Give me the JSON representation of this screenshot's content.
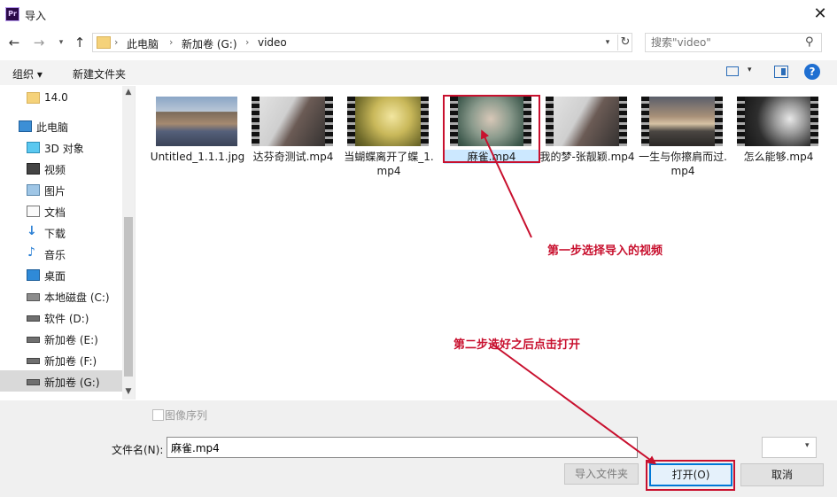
{
  "window": {
    "title": "导入",
    "app_badge": "Pr"
  },
  "address": {
    "crumbs": [
      "此电脑",
      "新加卷 (G:)",
      "video"
    ],
    "search_placeholder": "搜索\"video\""
  },
  "toolbar": {
    "organize": "组织 ▾",
    "new_folder": "新建文件夹"
  },
  "sidebar": {
    "items": [
      {
        "label": "14.0",
        "icon": "folder-icon"
      },
      {
        "label": "此电脑",
        "icon": "computer-icon"
      },
      {
        "label": "3D 对象",
        "icon": "3d-objects-icon"
      },
      {
        "label": "视频",
        "icon": "video-folder-icon"
      },
      {
        "label": "图片",
        "icon": "pictures-folder-icon"
      },
      {
        "label": "文档",
        "icon": "documents-folder-icon"
      },
      {
        "label": "下载",
        "icon": "download-arrow-icon"
      },
      {
        "label": "音乐",
        "icon": "music-note-icon"
      },
      {
        "label": "桌面",
        "icon": "desktop-icon"
      },
      {
        "label": "本地磁盘 (C:)",
        "icon": "system-drive-icon"
      },
      {
        "label": "软件 (D:)",
        "icon": "drive-icon"
      },
      {
        "label": "新加卷 (E:)",
        "icon": "drive-icon"
      },
      {
        "label": "新加卷 (F:)",
        "icon": "drive-icon"
      },
      {
        "label": "新加卷 (G:)",
        "icon": "drive-icon",
        "selected": true
      }
    ]
  },
  "files": [
    {
      "name": "Untitled_1.1.1.jpg",
      "kind": "image"
    },
    {
      "name": "达芬奇测试.mp4",
      "kind": "video"
    },
    {
      "name": "当蝴蝶离开了蝶_1.mp4",
      "kind": "video"
    },
    {
      "name": "麻雀.mp4",
      "kind": "video",
      "selected": true
    },
    {
      "name": "我的梦-张靓颖.mp4",
      "kind": "video"
    },
    {
      "name": "一生与你擦肩而过.mp4",
      "kind": "video"
    },
    {
      "name": "怎么能够.mp4",
      "kind": "video"
    }
  ],
  "annotations": {
    "step1": "第一步选择导入的视频",
    "step2": "第二步选好之后点击打开"
  },
  "bottom": {
    "image_sequence_label": "图像序列",
    "filename_label": "文件名(N):",
    "filename_value": "麻雀.mp4",
    "import_folder_button": "导入文件夹",
    "open_button": "打开(O)",
    "cancel_button": "取消"
  },
  "colors": {
    "accent": "#0078d7",
    "annotation": "#c8102e",
    "selection": "#cce8ff"
  }
}
